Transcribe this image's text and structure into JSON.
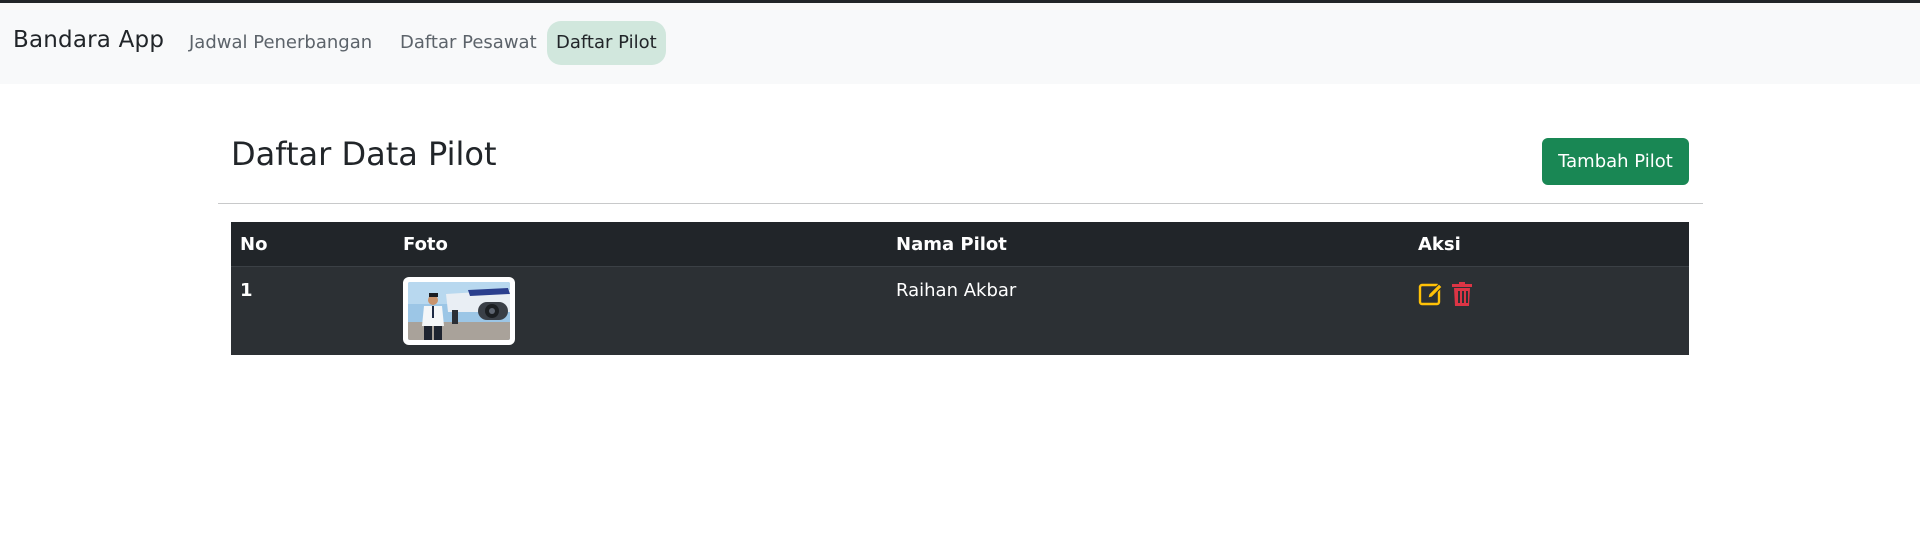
{
  "app": {
    "brand": "Bandara App"
  },
  "nav": [
    {
      "label": "Jadwal Penerbangan",
      "active": false
    },
    {
      "label": "Daftar Pesawat",
      "active": false
    },
    {
      "label": "Daftar Pilot",
      "active": true
    }
  ],
  "page": {
    "title": "Daftar Data Pilot",
    "add_button": "Tambah Pilot"
  },
  "table": {
    "columns": [
      "No",
      "Foto",
      "Nama Pilot",
      "Aksi"
    ],
    "rows": [
      {
        "no": "1",
        "photo": "pilot-photo",
        "name": "Raihan Akbar",
        "actions": [
          "edit-icon",
          "trash-icon"
        ]
      }
    ]
  },
  "colors": {
    "accent_green": "#198754",
    "active_nav": "#d1e7dd",
    "edit": "#ffc107",
    "delete": "#dc3545",
    "table_dark": "#212529"
  }
}
